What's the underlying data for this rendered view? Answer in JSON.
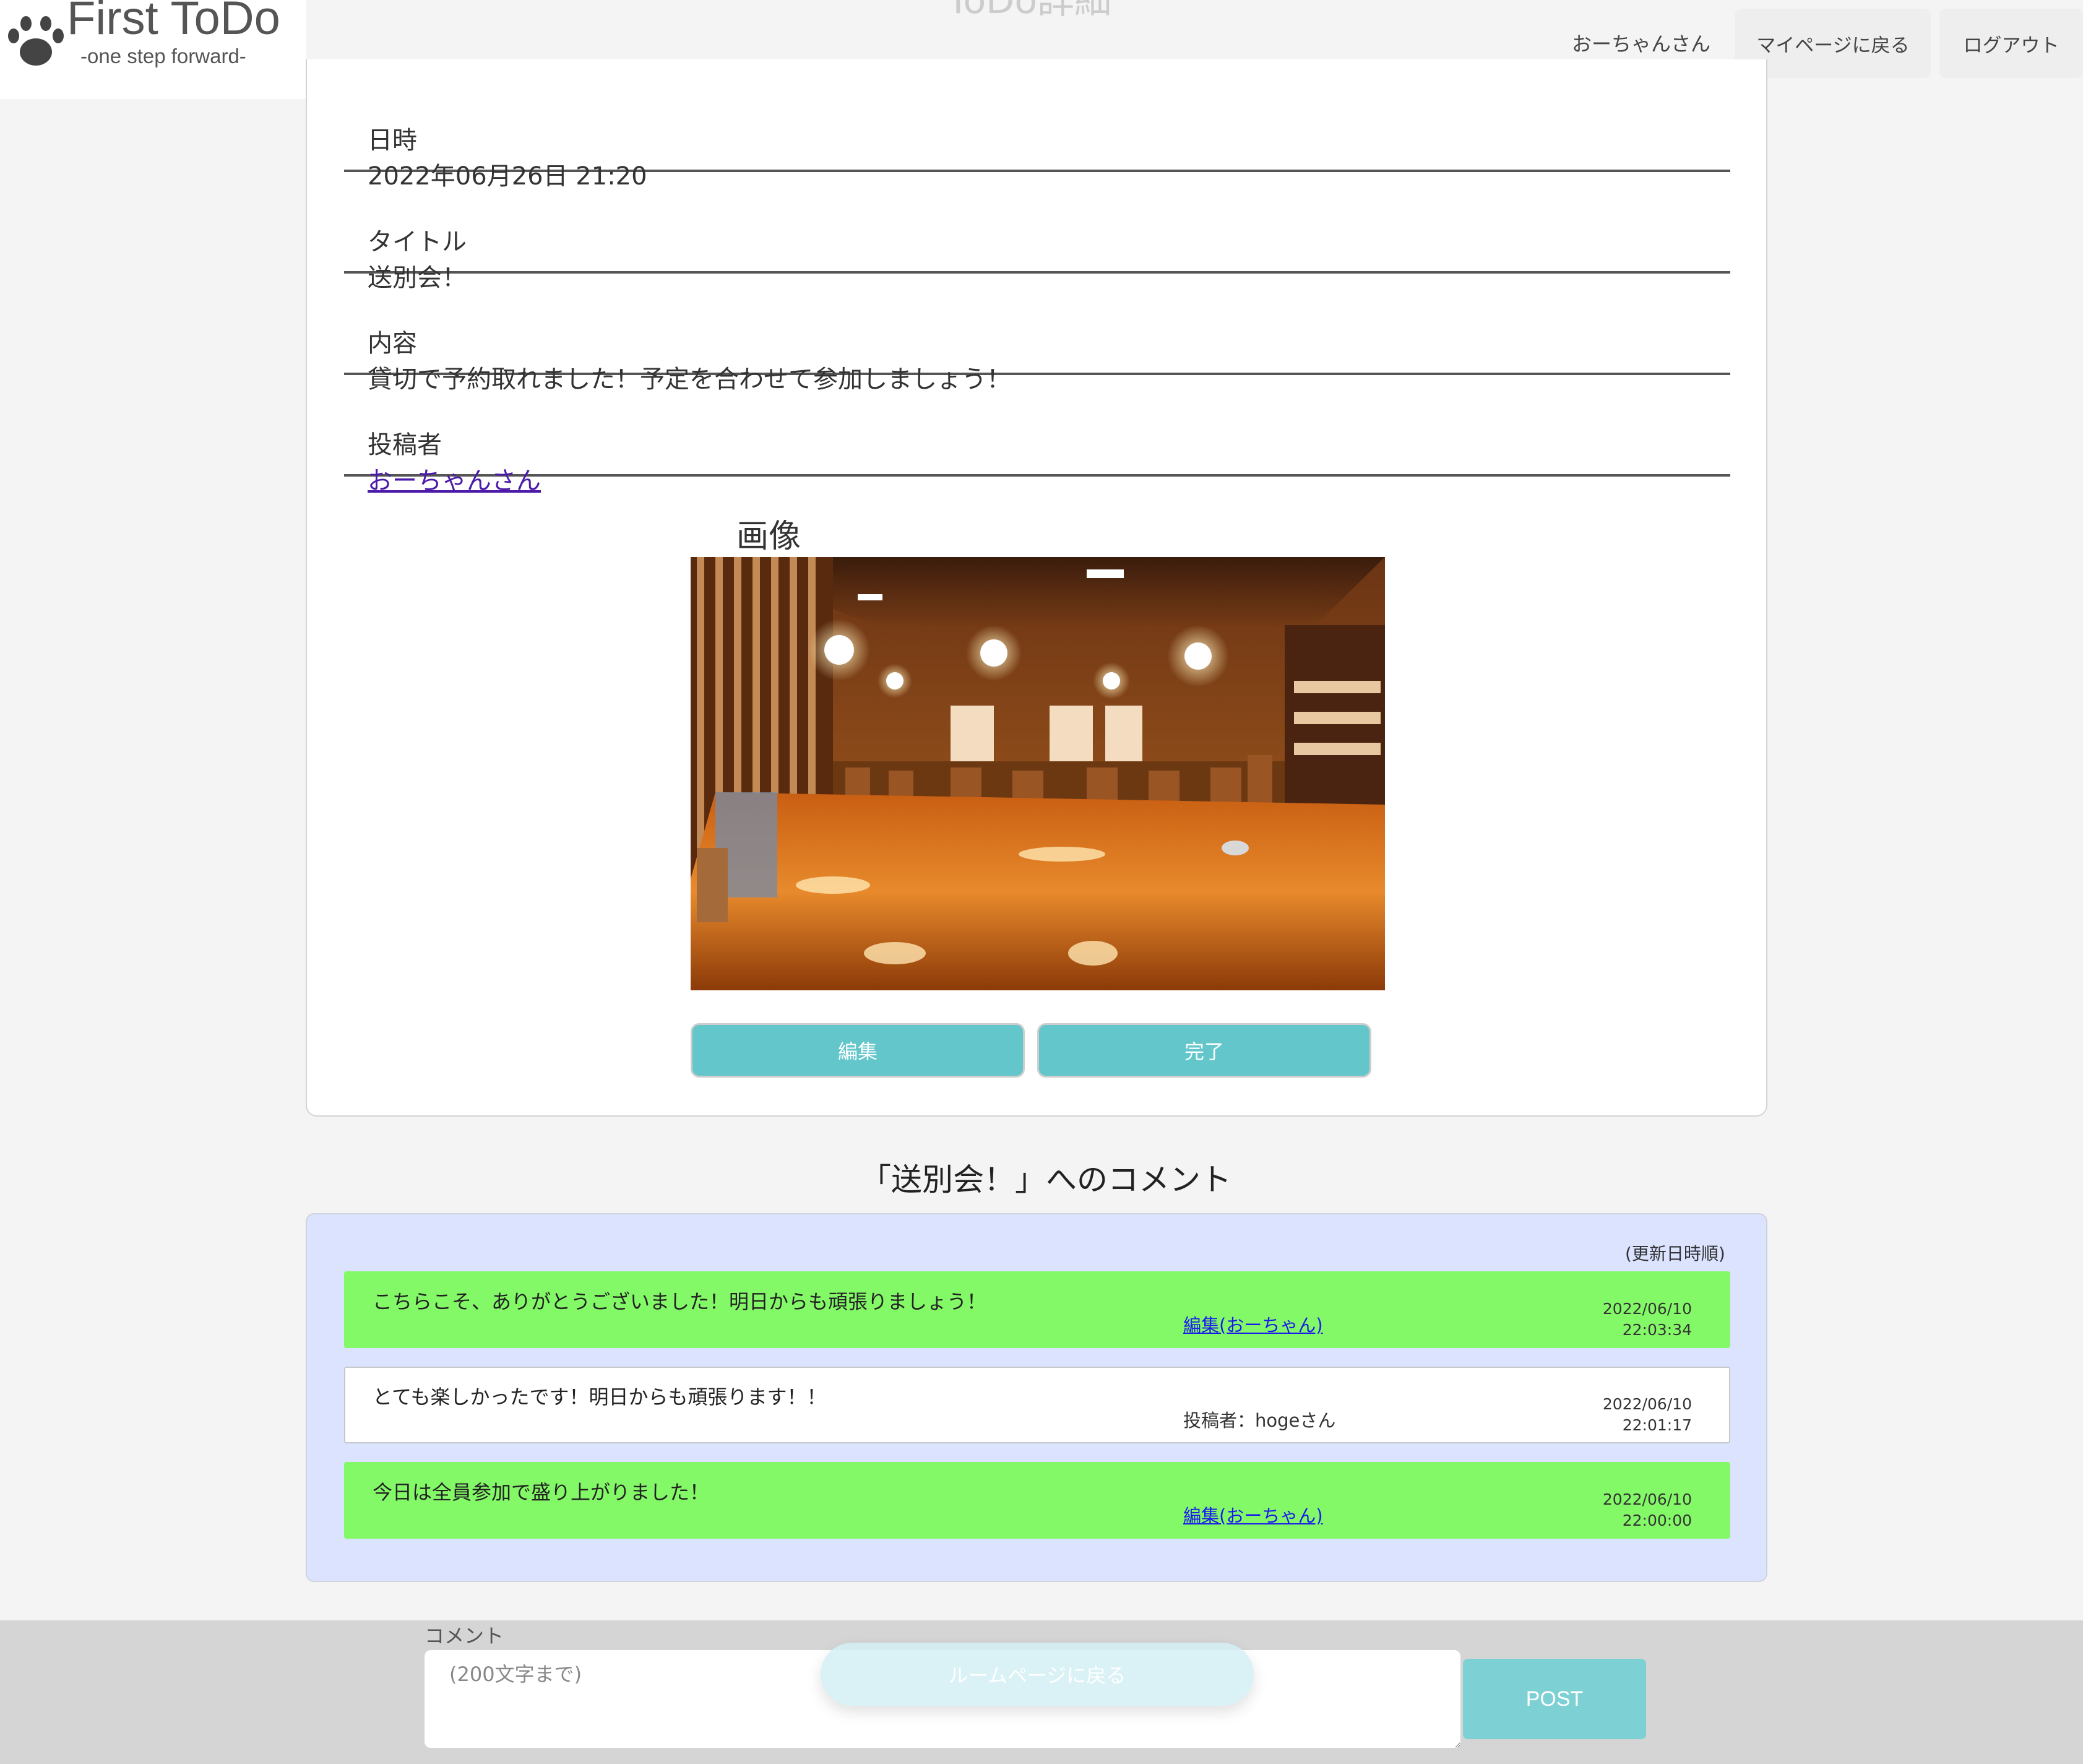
{
  "header": {
    "logo_title": "First ToDo",
    "logo_subtitle": "-one step forward-",
    "page_heading": "ToDo詳細",
    "user_name": "おーちゃんさん",
    "mypage_label": "マイページに戻る",
    "logout_label": "ログアウト"
  },
  "detail": {
    "datetime_label": "日時",
    "datetime_value": "2022年06月26日 21:20",
    "title_label": "タイトル",
    "title_value": "送別会！",
    "content_label": "内容",
    "content_value": "貸切で予約取れました！予定を合わせて参加しましょう！",
    "poster_label": "投稿者",
    "poster_value": "おーちゃんさん",
    "image_label": "画像",
    "edit_label": "編集",
    "done_label": "完了"
  },
  "comments": {
    "heading": "「送別会！」へのコメント",
    "sort_note": "(更新日時順)",
    "items": [
      {
        "text": "こちらこそ、ありがとうございました！明日からも頑張りましょう！",
        "meta": "編集(おーちゃん)",
        "date": "2022/06/10",
        "time": "22:03:34"
      },
      {
        "text": "とても楽しかったです！明日からも頑張ります！！",
        "meta": "投稿者：hogeさん",
        "date": "2022/06/10",
        "time": "22:01:17"
      },
      {
        "text": "今日は全員参加で盛り上がりました！",
        "meta": "編集(おーちゃん)",
        "date": "2022/06/10",
        "time": "22:00:00"
      }
    ]
  },
  "footer": {
    "comment_label": "コメント",
    "comment_placeholder": "(200文字まで)",
    "room_label": "ルームページに戻る",
    "post_label": "POST"
  },
  "colors": {
    "accent_button": "#63c6ca",
    "own_comment": "#84f967",
    "comments_panel": "#dbe3ff",
    "post_button": "#7dd1d4"
  },
  "icons": {
    "logo": "paw-icon"
  }
}
